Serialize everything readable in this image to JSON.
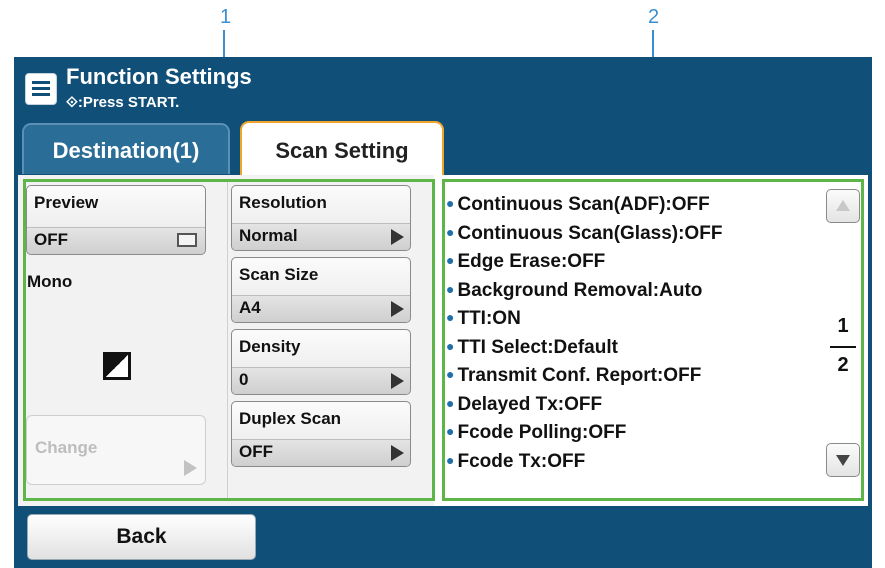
{
  "callouts": [
    "1",
    "2"
  ],
  "header": {
    "title": "Function Settings",
    "subtitle": "⟐:Press START."
  },
  "tabs": [
    {
      "label": "Destination(1)",
      "active": false
    },
    {
      "label": "Scan Setting",
      "active": true
    }
  ],
  "left_panel": {
    "preview": {
      "label": "Preview",
      "value": "OFF"
    },
    "mono_label": "Mono",
    "change_button": {
      "label": "Change",
      "enabled": false
    },
    "settings": [
      {
        "label": "Resolution",
        "value": "Normal"
      },
      {
        "label": "Scan Size",
        "value": "A4"
      },
      {
        "label": "Density",
        "value": "0"
      },
      {
        "label": "Duplex Scan",
        "value": "OFF"
      }
    ]
  },
  "summary_list": [
    "Continuous Scan(ADF):OFF",
    "Continuous Scan(Glass):OFF",
    "Edge Erase:OFF",
    "Background Removal:Auto",
    "TTI:ON",
    "TTI Select:Default",
    "Transmit Conf. Report:OFF",
    "Delayed Tx:OFF",
    "Fcode Polling:OFF",
    "Fcode Tx:OFF"
  ],
  "pager": {
    "current": "1",
    "total": "2"
  },
  "footer": {
    "back_label": "Back"
  },
  "colors": {
    "header_bg": "#0f4f78",
    "active_tab_border": "#f0a52a",
    "highlight_outline": "#5eb548",
    "callout": "#3a8fd0",
    "bullet": "#1f6fa8"
  },
  "icons": {
    "menu": "menu-list-icon",
    "start": "start-diamond-icon",
    "preview": "preview-screen-icon",
    "mono": "mono-color-icon",
    "next": "chevron-right-icon",
    "scroll_up": "scroll-up-icon",
    "scroll_down": "scroll-down-icon"
  }
}
